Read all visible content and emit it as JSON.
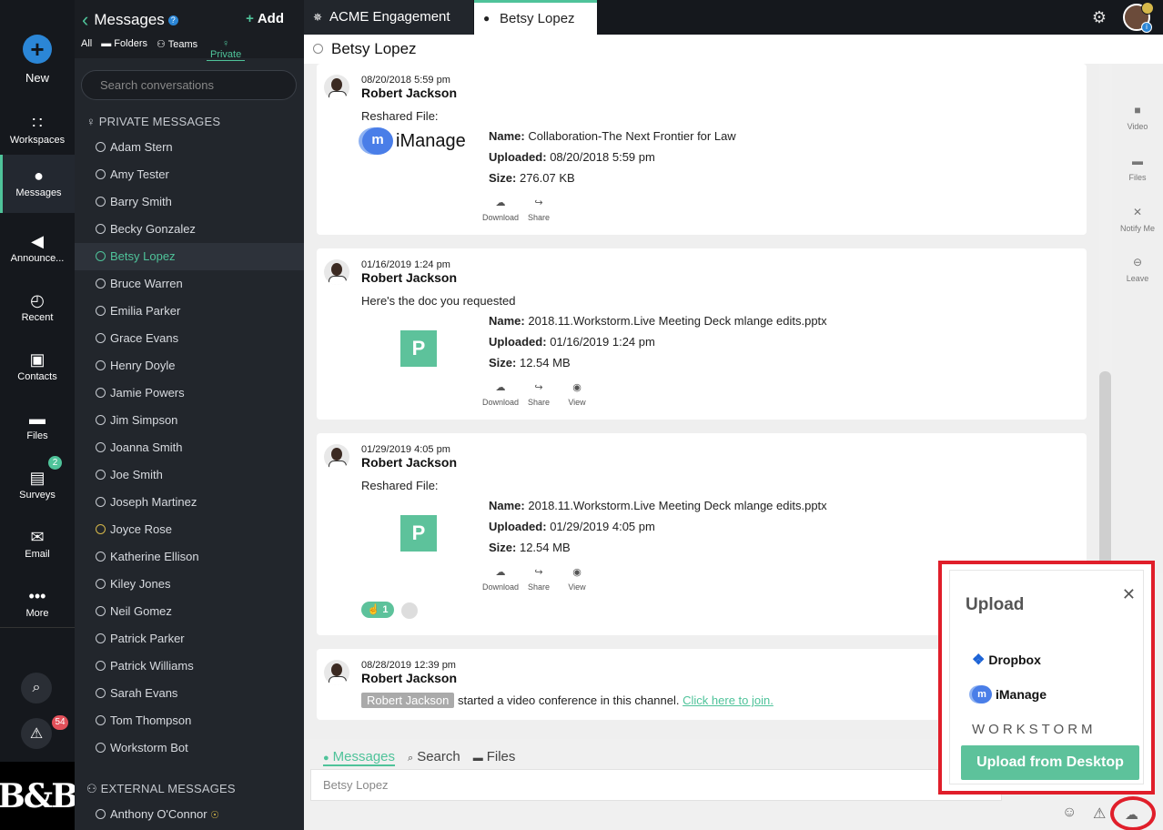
{
  "rail": {
    "new_label": "New",
    "items": [
      {
        "label": "Workspaces",
        "icon": "grid-icon"
      },
      {
        "label": "Messages",
        "icon": "chat-icon"
      },
      {
        "label": "Announce...",
        "icon": "megaphone-icon"
      },
      {
        "label": "Recent",
        "icon": "clock-icon"
      },
      {
        "label": "Contacts",
        "icon": "contacts-icon"
      },
      {
        "label": "Files",
        "icon": "folder-icon"
      },
      {
        "label": "Surveys",
        "icon": "clipboard-icon"
      },
      {
        "label": "Email",
        "icon": "envelope-icon"
      },
      {
        "label": "More",
        "icon": "dots-icon"
      }
    ],
    "surveys_badge": "2",
    "alerts_badge": "54",
    "logo_text": "B&B"
  },
  "sidebar": {
    "title": "Messages",
    "add_label": "Add",
    "filters": {
      "all": "All",
      "folders": "Folders",
      "teams": "Teams",
      "private": "Private"
    },
    "search_placeholder": "Search conversations",
    "private_heading": "PRIVATE MESSAGES",
    "external_heading": "EXTERNAL MESSAGES",
    "private": [
      "Adam Stern",
      "Amy Tester",
      "Barry Smith",
      "Becky Gonzalez",
      "Betsy Lopez",
      "Bruce Warren",
      "Emilia Parker",
      "Grace Evans",
      "Henry Doyle",
      "Jamie Powers",
      "Jim Simpson",
      "Joanna Smith",
      "Joe Smith",
      "Joseph Martinez",
      "Joyce Rose",
      "Katherine Ellison",
      "Kiley Jones",
      "Neil Gomez",
      "Patrick Parker",
      "Patrick Williams",
      "Sarah Evans",
      "Tom Thompson",
      "Workstorm Bot"
    ],
    "external": [
      "Anthony O'Connor"
    ]
  },
  "tabs": {
    "tab1": "ACME Engagement",
    "tab2": "Betsy Lopez"
  },
  "channel": {
    "name": "Betsy Lopez"
  },
  "labels": {
    "name": "Name:",
    "uploaded": "Uploaded:",
    "size": "Size:",
    "download": "Download",
    "share": "Share",
    "view": "View"
  },
  "messages": [
    {
      "time": "08/20/2018 5:59 pm",
      "author": "Robert Jackson",
      "text": "Reshared File:",
      "file_name": "Collaboration-The Next Frontier for Law",
      "uploaded": "08/20/2018 5:59 pm",
      "size": "276.07 KB",
      "brand": "iManage"
    },
    {
      "time": "01/16/2019 1:24 pm",
      "author": "Robert Jackson",
      "text": "Here's the doc you requested",
      "file_name": "2018.11.Workstorm.Live Meeting Deck mlange edits.pptx",
      "uploaded": "01/16/2019 1:24 pm",
      "size": "12.54 MB",
      "thumb": "P"
    },
    {
      "time": "01/29/2019 4:05 pm",
      "author": "Robert Jackson",
      "text": "Reshared File:",
      "file_name": "2018.11.Workstorm.Live Meeting Deck mlange edits.pptx",
      "uploaded": "01/29/2019 4:05 pm",
      "size": "12.54 MB",
      "thumb": "P",
      "reaction_count": "1"
    },
    {
      "time": "08/28/2019 12:39 pm",
      "author": "Robert Jackson",
      "system_user": "Robert Jackson",
      "system_text": "started a video conference in this channel.",
      "link": "Click here to join."
    }
  ],
  "composer": {
    "tabs": [
      "Messages",
      "Search",
      "Files"
    ],
    "placeholder": "Betsy Lopez"
  },
  "right_actions": [
    "Video",
    "Files",
    "Notify Me",
    "Leave"
  ],
  "upload": {
    "title": "Upload",
    "options": [
      "Dropbox",
      "iManage",
      "WORKSTORM"
    ],
    "button": "Upload from Desktop"
  },
  "colors": {
    "accent": "#4fc39a",
    "highlight": "#e01e2a",
    "sidebar": "#22262c",
    "rail": "#15181d"
  }
}
